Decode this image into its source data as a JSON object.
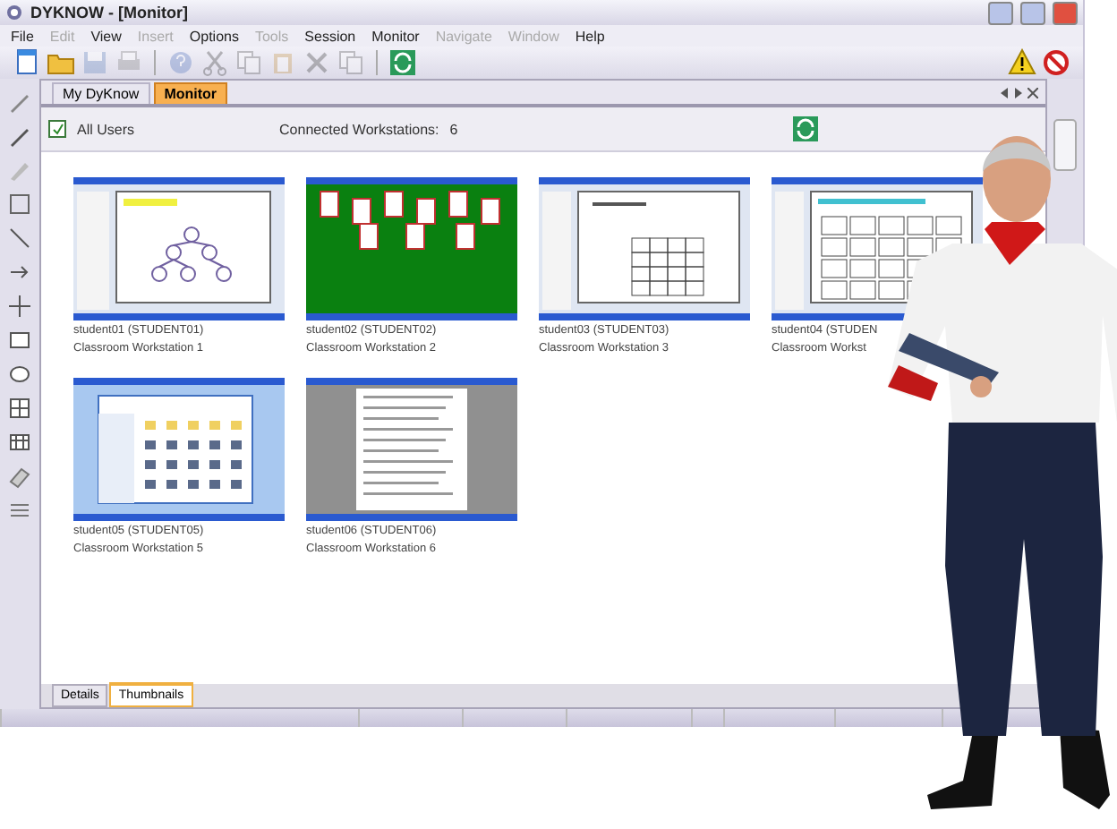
{
  "window": {
    "title": "DYKNOW - [Monitor]"
  },
  "menu": [
    {
      "label": "File",
      "disabled": false
    },
    {
      "label": "Edit",
      "disabled": true
    },
    {
      "label": "View",
      "disabled": false
    },
    {
      "label": "Insert",
      "disabled": true
    },
    {
      "label": "Options",
      "disabled": false
    },
    {
      "label": "Tools",
      "disabled": true
    },
    {
      "label": "Session",
      "disabled": false
    },
    {
      "label": "Monitor",
      "disabled": false
    },
    {
      "label": "Navigate",
      "disabled": true
    },
    {
      "label": "Window",
      "disabled": true
    },
    {
      "label": "Help",
      "disabled": false
    }
  ],
  "toolbar": [
    {
      "kind": "new",
      "disabled": false
    },
    {
      "kind": "open",
      "disabled": false
    },
    {
      "kind": "save",
      "disabled": true
    },
    {
      "kind": "print",
      "disabled": true
    },
    {
      "kind": "sep"
    },
    {
      "kind": "help",
      "disabled": true
    },
    {
      "kind": "cut",
      "disabled": true
    },
    {
      "kind": "copy",
      "disabled": true
    },
    {
      "kind": "paste",
      "disabled": true
    },
    {
      "kind": "delete",
      "disabled": true
    },
    {
      "kind": "copy",
      "disabled": true
    },
    {
      "kind": "sep"
    },
    {
      "kind": "refresh",
      "disabled": false
    }
  ],
  "alerts": [
    {
      "kind": "warning"
    },
    {
      "kind": "block"
    }
  ],
  "tabs": [
    {
      "label": "My DyKnow",
      "selected": false
    },
    {
      "label": "Monitor",
      "selected": true
    }
  ],
  "header": {
    "all_users": {
      "label": "All Users",
      "checked": true
    },
    "connected": "Connected Workstations:",
    "count": "6"
  },
  "workstations": [
    {
      "name": "student01 (STUDENT01)",
      "location": "Classroom Workstation 1",
      "kind": "slide"
    },
    {
      "name": "student02 (STUDENT02)",
      "location": "Classroom Workstation 2",
      "kind": "cards"
    },
    {
      "name": "student03 (STUDENT03)",
      "location": "Classroom Workstation 3",
      "kind": "grid"
    },
    {
      "name": "student04 (STUDEN",
      "location": "Classroom Workst",
      "kind": "table"
    },
    {
      "name": "student05 (STUDENT05)",
      "location": "Classroom Workstation 5",
      "kind": "explorer"
    },
    {
      "name": "student06 (STUDENT06)",
      "location": "Classroom Workstation 6",
      "kind": "document"
    }
  ],
  "view_tabs": [
    {
      "label": "Details",
      "selected": false
    },
    {
      "label": "Thumbnails",
      "selected": true
    }
  ]
}
